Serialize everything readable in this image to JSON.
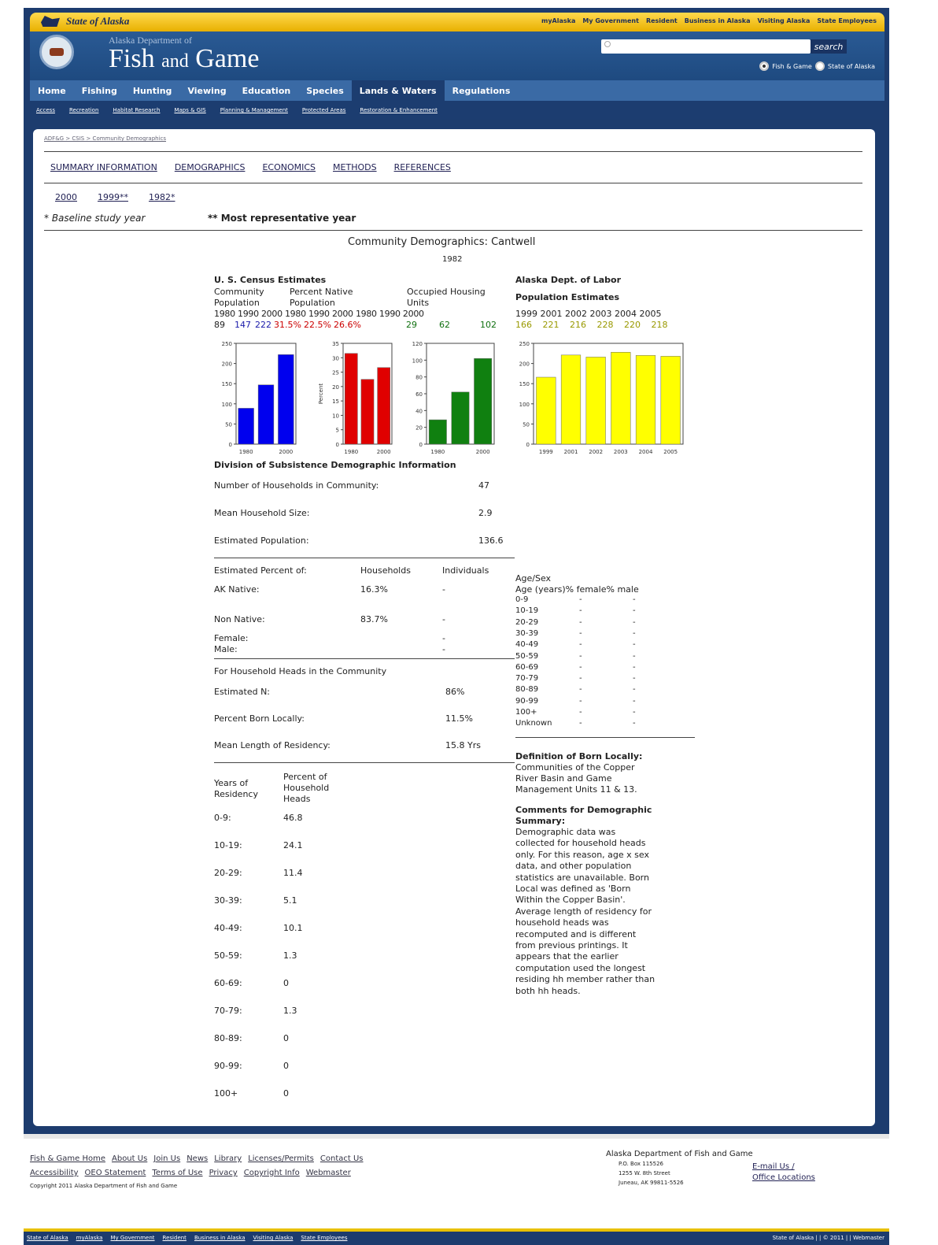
{
  "topbar": {
    "brand": "State of Alaska",
    "links": [
      "myAlaska",
      "My Government",
      "Resident",
      "Business in Alaska",
      "Visiting Alaska",
      "State Employees"
    ]
  },
  "header": {
    "dept_sub": "Alaska Department of",
    "dept_main_1": "Fish",
    "dept_main_2": "and",
    "dept_main_3": "Game",
    "search_placeholder": "",
    "search_button": "search",
    "radio_1": "Fish & Game",
    "radio_2": "State of Alaska"
  },
  "mainnav": [
    "Home",
    "Fishing",
    "Hunting",
    "Viewing",
    "Education",
    "Species",
    "Lands & Waters",
    "Regulations"
  ],
  "subnav": [
    "Access",
    "Recreation",
    "Habitat Research",
    "Maps & GIS",
    "Planning & Management",
    "Protected Areas",
    "Restoration & Enhancement"
  ],
  "breadcrumb": "ADF&G > CSIS > Community Demographics",
  "tabs": [
    "SUMMARY INFORMATION",
    "DEMOGRAPHICS",
    "ECONOMICS",
    "METHODS",
    "REFERENCES"
  ],
  "years": [
    "2000",
    "1999**",
    "1982*"
  ],
  "legend": {
    "baseline": "* Baseline study year",
    "representative": "** Most representative year"
  },
  "title": "Community Demographics: Cantwell",
  "subyear": "1982",
  "census": {
    "heading": "U. S. Census Estimates",
    "col1": "Community Population",
    "col1a": "Community",
    "col1b": "Population",
    "col2a": "Percent Native",
    "col2b": "Population",
    "col3a": "Occupied Housing",
    "col3b": "Units",
    "years_row": "1980 1990 2000 1980  1990  2000  1980  1990   2000",
    "pop_values": [
      "89",
      "147",
      "222"
    ],
    "pct_values": [
      "31.5%",
      "22.5%",
      "26.6%"
    ],
    "hu_values": [
      "29",
      "62",
      "102"
    ]
  },
  "labor": {
    "heading": "Alaska Dept. of Labor",
    "sub": "Population Estimates",
    "years_row": "1999 2001 2002 2003 2004 2005",
    "values": [
      "166",
      "221",
      "216",
      "228",
      "220",
      "218"
    ]
  },
  "chart_data": [
    {
      "type": "bar",
      "categories": [
        "1980",
        "1990",
        "2000"
      ],
      "values": [
        89,
        147,
        222
      ],
      "ylim": [
        0,
        250
      ],
      "yticks": [
        "0",
        "50",
        "100",
        "150",
        "200",
        "250"
      ],
      "xticks": [
        "1980",
        "2000"
      ],
      "color": "#0000ee"
    },
    {
      "type": "bar",
      "categories": [
        "1980",
        "1990",
        "2000"
      ],
      "values": [
        31.5,
        22.5,
        26.6
      ],
      "ylim": [
        0,
        35
      ],
      "yticks": [
        "0",
        "5",
        "10",
        "15",
        "20",
        "25",
        "30",
        "35"
      ],
      "xticks": [
        "1980",
        "2000"
      ],
      "ylabel": "Percent",
      "color": "#e00000"
    },
    {
      "type": "bar",
      "categories": [
        "1980",
        "1990",
        "2000"
      ],
      "values": [
        29,
        62,
        102
      ],
      "ylim": [
        0,
        120
      ],
      "yticks": [
        "0",
        "20",
        "40",
        "60",
        "80",
        "100",
        "120"
      ],
      "xticks": [
        "1980",
        "2000"
      ],
      "color": "#108010"
    },
    {
      "type": "bar",
      "categories": [
        "1999",
        "2001",
        "2002",
        "2003",
        "2004",
        "2005"
      ],
      "values": [
        166,
        221,
        216,
        228,
        220,
        218
      ],
      "ylim": [
        0,
        250
      ],
      "yticks": [
        "0",
        "50",
        "100",
        "150",
        "200",
        "250"
      ],
      "xticks": [
        "1999",
        "2001",
        "2002",
        "2003",
        "2004",
        "2005"
      ],
      "color": "#ffff00"
    }
  ],
  "division": {
    "heading": "Division of Subsistence Demographic Information",
    "households_label": "Number of Households in Community:",
    "households_value": "47",
    "mean_size_label": "Mean Household Size:",
    "mean_size_value": "2.9",
    "est_pop_label": "Estimated Population:",
    "est_pop_value": "136.6",
    "pct_of": "Estimated Percent of:",
    "households_col": "Households",
    "individuals_col": "Individuals",
    "ak_native": "AK Native:",
    "ak_native_hh": "16.3%",
    "ak_native_ind": "-",
    "non_native": "Non Native:",
    "non_native_hh": "83.7%",
    "non_native_ind": "-",
    "female": "Female:",
    "female_ind": "-",
    "male": "Male:",
    "male_ind": "-",
    "heads_heading": "For Household Heads in the Community",
    "est_n_label": "Estimated N:",
    "est_n_value": "86%",
    "born_local_label": "Percent Born Locally:",
    "born_local_value": "11.5%",
    "mean_len_label": "Mean Length of Residency:",
    "mean_len_value": "15.8 Yrs"
  },
  "residency": {
    "col1": "Years of Residency",
    "col1a": "Years of",
    "col1b": "Residency",
    "col2a": "Percent of",
    "col2b": "Household",
    "col2c": "Heads",
    "rows": [
      {
        "range": "0-9:",
        "value": "46.8"
      },
      {
        "range": "10-19:",
        "value": "24.1"
      },
      {
        "range": "20-29:",
        "value": "11.4"
      },
      {
        "range": "30-39:",
        "value": "5.1"
      },
      {
        "range": "40-49:",
        "value": "10.1"
      },
      {
        "range": "50-59:",
        "value": "1.3"
      },
      {
        "range": "60-69:",
        "value": "0"
      },
      {
        "range": "70-79:",
        "value": "1.3"
      },
      {
        "range": "80-89:",
        "value": "0"
      },
      {
        "range": "90-99:",
        "value": "0"
      },
      {
        "range": "100+",
        "value": "0"
      }
    ]
  },
  "agesex": {
    "heading": "Age/Sex",
    "cols": "Age (years)% female% male",
    "rows": [
      {
        "age": "0-9",
        "f": "-",
        "m": "-"
      },
      {
        "age": "10-19",
        "f": "-",
        "m": "-"
      },
      {
        "age": "20-29",
        "f": "-",
        "m": "-"
      },
      {
        "age": "30-39",
        "f": "-",
        "m": "-"
      },
      {
        "age": "40-49",
        "f": "-",
        "m": "-"
      },
      {
        "age": "50-59",
        "f": "-",
        "m": "-"
      },
      {
        "age": "60-69",
        "f": "-",
        "m": "-"
      },
      {
        "age": "70-79",
        "f": "-",
        "m": "-"
      },
      {
        "age": "80-89",
        "f": "-",
        "m": "-"
      },
      {
        "age": "90-99",
        "f": "-",
        "m": "-"
      },
      {
        "age": "100+",
        "f": "-",
        "m": "-"
      },
      {
        "age": "Unknown",
        "f": "-",
        "m": "-"
      }
    ]
  },
  "definition": {
    "heading": "Definition of Born Locally:",
    "lines": [
      "Communities of the Copper",
      "River Basin and Game",
      "Management Units 11 & 13."
    ]
  },
  "comments": {
    "heading1": "Comments for Demographic",
    "heading2": "Summary:",
    "lines": [
      "Demographic data was",
      "collected for household heads",
      "only. For this reason, age x sex",
      "data, and other population",
      "statistics are unavailable. Born",
      "Local was defined as 'Born",
      "Within the Copper Basin'.",
      "Average length of residency for",
      "household heads was",
      "recomputed and is different",
      "from previous printings. It",
      "appears that the earlier",
      "computation used the longest",
      "residing hh member rather than",
      "both hh heads."
    ]
  },
  "footer": {
    "links1": [
      "Fish & Game Home",
      "About Us",
      "Join Us",
      "News",
      "Library",
      "Licenses/Permits",
      "Contact Us"
    ],
    "links2": [
      "Accessibility",
      "OEO Statement",
      "Terms of Use",
      "Privacy",
      "Copyright Info",
      "Webmaster"
    ],
    "copyright": "Copyright 2011 Alaska Department of Fish and Game",
    "org": "Alaska Department of Fish and Game",
    "addr1": "P.O. Box 115526",
    "addr2": "1255 W. 8th Street",
    "addr3": "Juneau, AK 99811-5526",
    "email": "E-mail Us /",
    "offices": "Office Locations"
  },
  "bottombar": {
    "links": [
      "State of Alaska",
      "myAlaska",
      "My Government",
      "Resident",
      "Business in Alaska",
      "Visiting Alaska",
      "State Employees"
    ],
    "right": "State of Alaska | | © 2011 | | Webmaster"
  }
}
